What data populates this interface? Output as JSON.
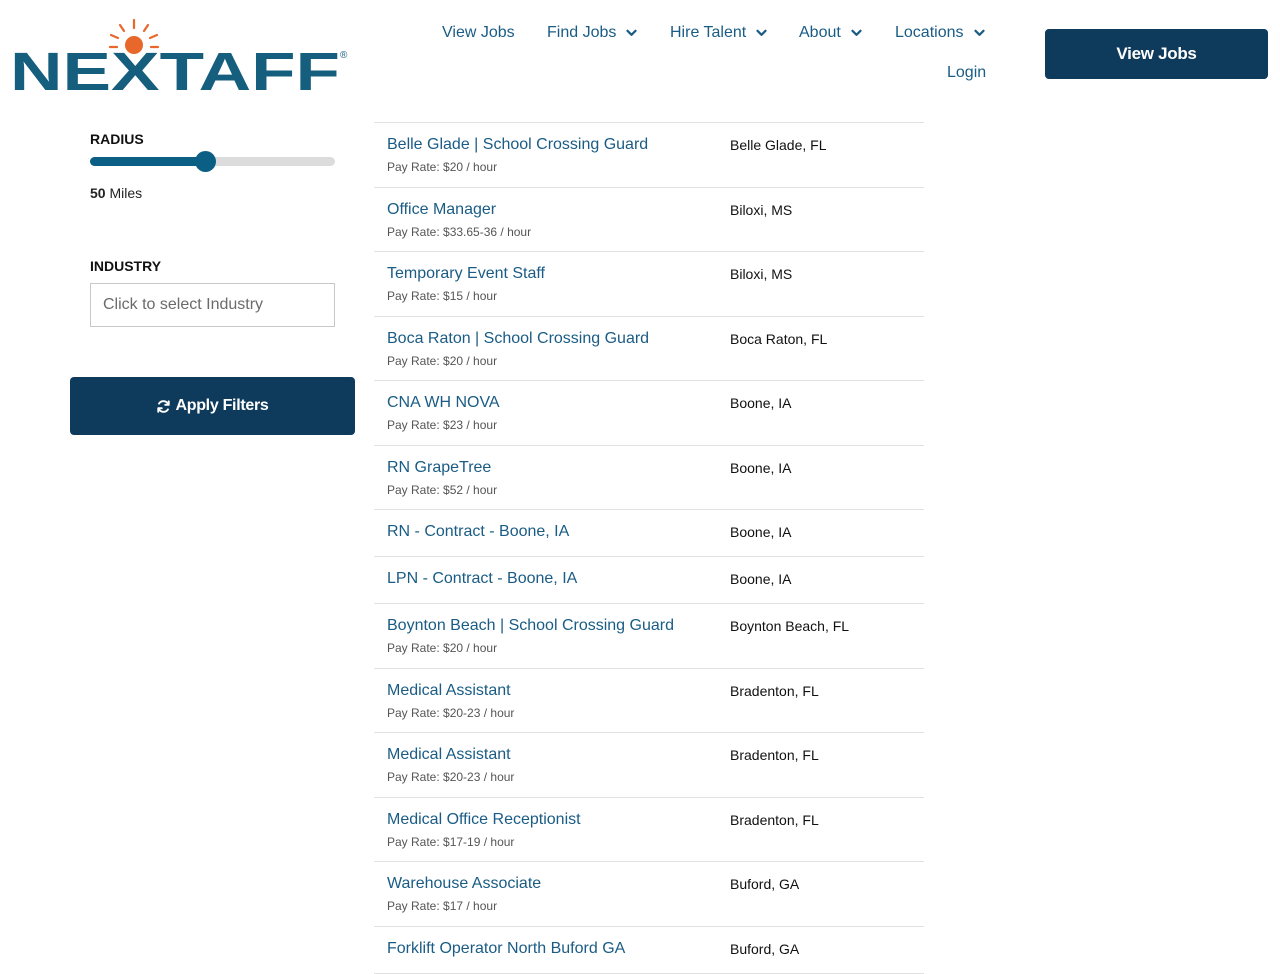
{
  "brand": {
    "logo_text": "NEXTAFF",
    "colors": {
      "navy": "#0e3a5c",
      "link": "#1a5c85",
      "orange": "#e8672a",
      "teal": "#155e7e"
    }
  },
  "nav": {
    "items": [
      {
        "label": "View Jobs",
        "dropdown": false
      },
      {
        "label": "Find Jobs",
        "dropdown": true
      },
      {
        "label": "Hire Talent",
        "dropdown": true
      },
      {
        "label": "About",
        "dropdown": true
      },
      {
        "label": "Locations",
        "dropdown": true
      }
    ],
    "login": "Login",
    "cta": "View Jobs"
  },
  "filters": {
    "radius_label": "RADIUS",
    "radius_value": "50",
    "radius_unit": "Miles",
    "radius_fraction": 0.47,
    "industry_label": "INDUSTRY",
    "industry_placeholder": "Click to select Industry",
    "apply_label": "Apply Filters",
    "apply_icon": "refresh-icon"
  },
  "jobs": [
    {
      "title": "Belle Glade | School Crossing Guard",
      "pay": "Pay Rate: $20 / hour",
      "location": "Belle Glade, FL"
    },
    {
      "title": "Office Manager",
      "pay": "Pay Rate: $33.65-36 / hour",
      "location": "Biloxi, MS"
    },
    {
      "title": "Temporary Event Staff",
      "pay": "Pay Rate: $15 / hour",
      "location": "Biloxi, MS"
    },
    {
      "title": "Boca Raton | School Crossing Guard",
      "pay": "Pay Rate: $20 / hour",
      "location": "Boca Raton, FL"
    },
    {
      "title": "CNA WH NOVA",
      "pay": "Pay Rate: $23 / hour",
      "location": "Boone, IA"
    },
    {
      "title": "RN GrapeTree",
      "pay": "Pay Rate: $52 / hour",
      "location": "Boone, IA"
    },
    {
      "title": "RN - Contract - Boone, IA",
      "pay": "",
      "location": "Boone, IA"
    },
    {
      "title": "LPN - Contract - Boone, IA",
      "pay": "",
      "location": "Boone, IA"
    },
    {
      "title": "Boynton Beach | School Crossing Guard",
      "pay": "Pay Rate: $20 / hour",
      "location": "Boynton Beach, FL"
    },
    {
      "title": "Medical Assistant",
      "pay": "Pay Rate: $20-23 / hour",
      "location": "Bradenton, FL"
    },
    {
      "title": "Medical Assistant",
      "pay": "Pay Rate: $20-23 / hour",
      "location": "Bradenton, FL"
    },
    {
      "title": "Medical Office Receptionist",
      "pay": "Pay Rate: $17-19 / hour",
      "location": "Bradenton, FL"
    },
    {
      "title": "Warehouse Associate",
      "pay": "Pay Rate: $17 / hour",
      "location": "Buford, GA"
    },
    {
      "title": "Forklift Operator North Buford GA",
      "pay": "",
      "location": "Buford, GA"
    }
  ]
}
